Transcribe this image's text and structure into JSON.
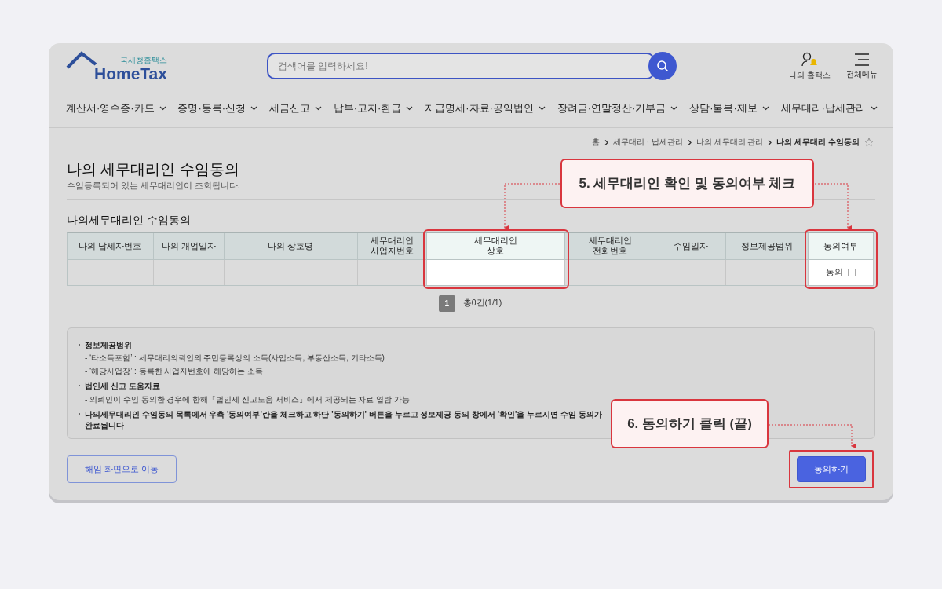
{
  "logo": {
    "subtitle": "국세청홈택스",
    "name": "HomeTax"
  },
  "search": {
    "placeholder": "검색어를 입력하세요!"
  },
  "header_links": [
    {
      "label": "나의 홈택스",
      "kind": "user"
    },
    {
      "label": "전체메뉴",
      "kind": "menu"
    }
  ],
  "nav": [
    "계산서·영수증·카드",
    "증명·등록·신청",
    "세금신고",
    "납부·고지·환급",
    "지급명세·자료·공익법인",
    "장려금·연말정산·기부금",
    "상담·불복·제보",
    "세무대리·납세관리"
  ],
  "breadcrumb": [
    "홈",
    "세무대리 · 납세관리",
    "나의 세무대리 관리",
    "나의 세무대리 수임동의"
  ],
  "page": {
    "title": "나의 세무대리인 수임동의",
    "subtitle": "수임등록되어 있는 세무대리인이 조회됩니다."
  },
  "section_title": "나의세무대리인 수임동의",
  "table": {
    "columns": [
      {
        "label": "나의 납세자번호",
        "highlighted": false
      },
      {
        "label": "나의 개업일자",
        "highlighted": false
      },
      {
        "label": "나의 상호명",
        "highlighted": false
      },
      {
        "label": "세무대리인\n사업자번호",
        "highlighted": false
      },
      {
        "label": "세무대리인\n상호",
        "highlighted": true
      },
      {
        "label": "세무대리인\n전화번호",
        "highlighted": false
      },
      {
        "label": "수임일자",
        "highlighted": false
      },
      {
        "label": "정보제공범위",
        "highlighted": false
      },
      {
        "label": "동의여부",
        "highlighted": true
      }
    ],
    "rows": [
      {
        "consent_label": "동의",
        "checked": false
      }
    ]
  },
  "pagination": {
    "pages": [
      {
        "label": "1",
        "selected": true
      }
    ],
    "summary": "총0건(1/1)"
  },
  "notes": [
    {
      "heading": "정보제공범위",
      "items": [
        "- ‘타소득포함’ : 세무대리의뢰인의 주민등록상의 소득(사업소득, 부동산소득, 기타소득)",
        "- ‘해당사업장’ : 등록한 사업자번호에 해당하는 소득"
      ]
    },
    {
      "heading": "법인세 신고 도움자료",
      "items": [
        "- 의뢰인이 수임 동의한 경우에 한해「법인세 신고도움 서비스」에서 제공되는 자료 열람 가능"
      ]
    },
    {
      "heading": "나의세무대리인 수임동의 목록에서 우측 '동의여부'란을 체크하고 하단 '동의하기' 버튼을 누르고 정보제공 동의 창에서 '확인'을 누르시면 수임 동의가 완료됩니다"
    }
  ],
  "buttons": [
    {
      "label": "해임 화면으로 이동",
      "kind": "secondary",
      "highlighted": false
    },
    {
      "label": "동의하기",
      "kind": "primary",
      "highlighted": true
    }
  ],
  "callouts": [
    {
      "label": "5. 세무대리인 확인 및 동의여부 체크"
    },
    {
      "label": "6. 동의하기 클릭 (끝)"
    }
  ]
}
